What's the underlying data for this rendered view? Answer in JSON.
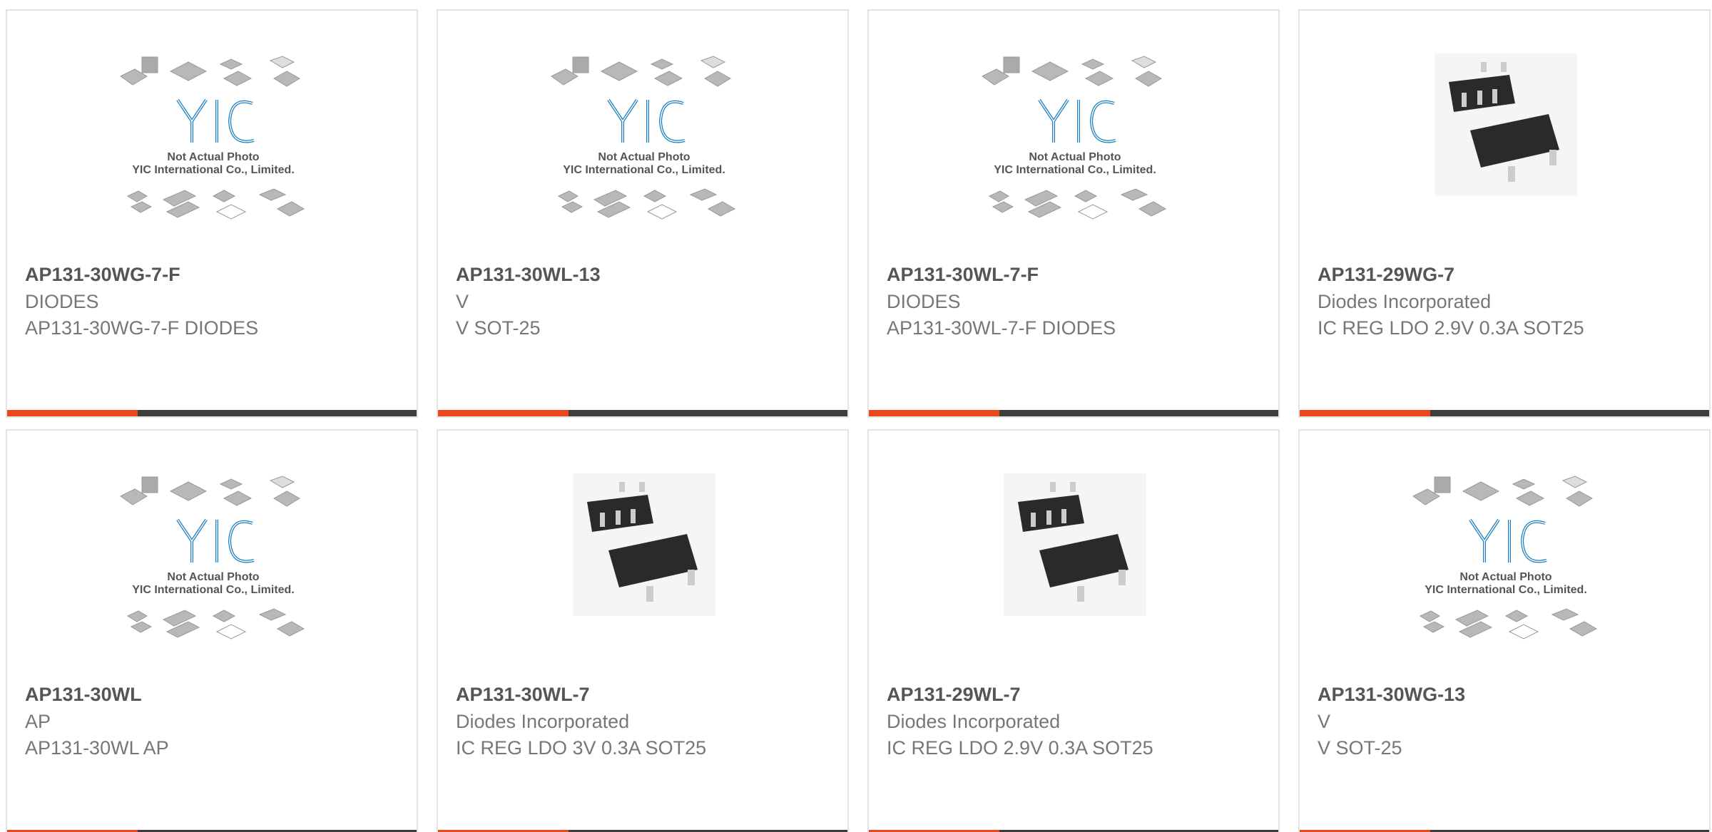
{
  "products": [
    {
      "part": "AP131-30WG-7-F",
      "manufacturer": "DIODES",
      "description": "AP131-30WG-7-F DIODES",
      "image": "yic-placeholder-icon"
    },
    {
      "part": "AP131-30WL-13",
      "manufacturer": "V",
      "description": "V SOT-25",
      "image": "yic-placeholder-icon"
    },
    {
      "part": "AP131-30WL-7-F",
      "manufacturer": "DIODES",
      "description": "AP131-30WL-7-F DIODES",
      "image": "yic-placeholder-icon"
    },
    {
      "part": "AP131-29WG-7",
      "manufacturer": "Diodes Incorporated",
      "description": "IC REG LDO 2.9V 0.3A SOT25",
      "image": "sot25-package-icon"
    },
    {
      "part": "AP131-30WL",
      "manufacturer": "AP",
      "description": "AP131-30WL AP",
      "image": "yic-placeholder-icon"
    },
    {
      "part": "AP131-30WL-7",
      "manufacturer": "Diodes Incorporated",
      "description": "IC REG LDO 3V 0.3A SOT25",
      "image": "sot25-package-icon"
    },
    {
      "part": "AP131-29WL-7",
      "manufacturer": "Diodes Incorporated",
      "description": "IC REG LDO 2.9V 0.3A SOT25",
      "image": "sot25-package-icon"
    },
    {
      "part": "AP131-30WG-13",
      "manufacturer": "V",
      "description": "V SOT-25",
      "image": "yic-placeholder-icon"
    }
  ],
  "placeholder": {
    "logo_text": "YIC",
    "line1": "Not Actual Photo",
    "line2": "YIC International Co., Limited."
  },
  "colors": {
    "accent": "#e8481c",
    "bar": "#3d3d3d",
    "logo_blue": "#1a7fc1",
    "chip": "#2a2a2a"
  }
}
